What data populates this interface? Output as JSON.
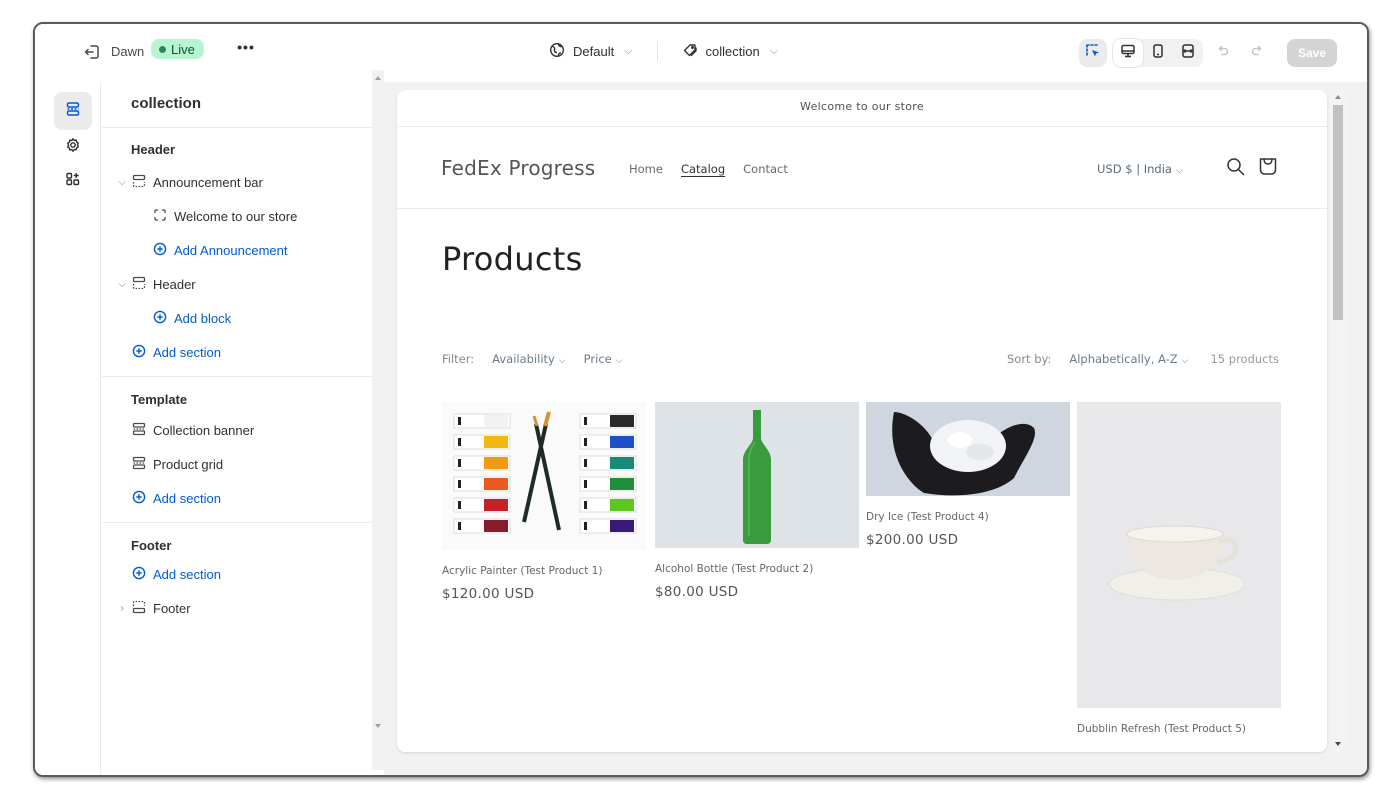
{
  "topbar": {
    "theme_name": "Dawn",
    "status_badge": "Live",
    "more_label": "•••",
    "template_selector": {
      "label": "Default",
      "icon": "globe-icon"
    },
    "page_selector": {
      "label": "collection",
      "icon": "tag-icon"
    },
    "view_modes": [
      "select-inspector",
      "desktop",
      "mobile",
      "full-width"
    ],
    "active_view": "desktop",
    "save_label": "Save"
  },
  "rail": {
    "items": [
      {
        "name": "sections",
        "icon": "sections-icon",
        "active": true
      },
      {
        "name": "theme-settings",
        "icon": "gear-icon",
        "active": false
      },
      {
        "name": "app-embeds",
        "icon": "apps-add-icon",
        "active": false
      }
    ]
  },
  "sidebar": {
    "title": "collection",
    "groups": [
      {
        "heading": "Header",
        "items": [
          {
            "label": "Announcement bar",
            "type": "section",
            "expanded": true
          },
          {
            "label": "Welcome to our store",
            "type": "block"
          },
          {
            "label": "Add Announcement",
            "type": "add"
          },
          {
            "label": "Header",
            "type": "section",
            "expanded": true
          },
          {
            "label": "Add block",
            "type": "add"
          },
          {
            "label": "Add section",
            "type": "add"
          }
        ]
      },
      {
        "heading": "Template",
        "items": [
          {
            "label": "Collection banner",
            "type": "section"
          },
          {
            "label": "Product grid",
            "type": "section"
          },
          {
            "label": "Add section",
            "type": "add"
          }
        ]
      },
      {
        "heading": "Footer",
        "items": [
          {
            "label": "Add section",
            "type": "add"
          },
          {
            "label": "Footer",
            "type": "section",
            "expanded": false
          }
        ]
      }
    ]
  },
  "store": {
    "announcement": "Welcome to our store",
    "logo": "FedEx Progress",
    "nav": [
      {
        "label": "Home",
        "current": false
      },
      {
        "label": "Catalog",
        "current": true
      },
      {
        "label": "Contact",
        "current": false
      }
    ],
    "currency": "USD $ | India",
    "page_title": "Products",
    "filter": {
      "label": "Filter:",
      "options": [
        "Availability",
        "Price"
      ]
    },
    "sort": {
      "label": "Sort by:",
      "value": "Alphabetically, A-Z",
      "count": "15 products"
    },
    "products": [
      {
        "name": "Acrylic Painter (Test Product 1)",
        "price": "$120.00 USD",
        "image": "paint-tubes-and-brushes"
      },
      {
        "name": "Alcohol Bottle (Test Product 2)",
        "price": "$80.00 USD",
        "image": "green-glass-bottle"
      },
      {
        "name": "Dry Ice (Test Product 4)",
        "price": "$200.00 USD",
        "image": "dry-ice-in-gloved-hands"
      },
      {
        "name": "Dubblin Refresh (Test Product 5)",
        "price": "",
        "image": "white-cup-and-saucer"
      }
    ]
  },
  "colors": {
    "accent_blue": "#005bd3",
    "live_badge_bg": "#b7f5d2",
    "live_badge_text": "#0c5132",
    "save_disabled": "#d4d4d4"
  }
}
